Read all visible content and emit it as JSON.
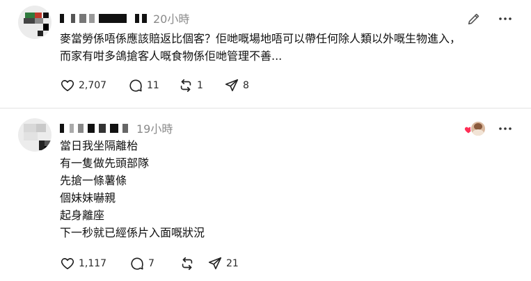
{
  "posts": [
    {
      "time": "20小時",
      "text": "麥當勞係唔係應該賠返比個客？佢哋嘅場地唔可以帶任何除人類以外嘅生物進入，\n而家有咁多鴿搶客人嘅食物係佢哋管理不善...",
      "likes": "2,707",
      "replies": "11",
      "reposts": "1",
      "shares": "8"
    },
    {
      "time": "19小時",
      "text": "當日我坐隔離枱\n有一隻做先頭部隊\n先搶一條薯條\n個妹妹嚇親\n起身離座\n下一秒就已經係片入面嘅狀況",
      "likes": "1,117",
      "replies": "7",
      "reposts": "",
      "shares": "21"
    }
  ],
  "icons": {
    "like": "heart-icon",
    "reply": "speech-bubble-icon",
    "repost": "repost-arrows-icon",
    "share": "send-icon",
    "edit": "pencil-icon",
    "more": "more-dots-icon",
    "liked_by_author": "heart-filled-icon"
  },
  "colors": {
    "liked_heart": "#ff2f56",
    "secondary_text": "#8a8a8a"
  }
}
